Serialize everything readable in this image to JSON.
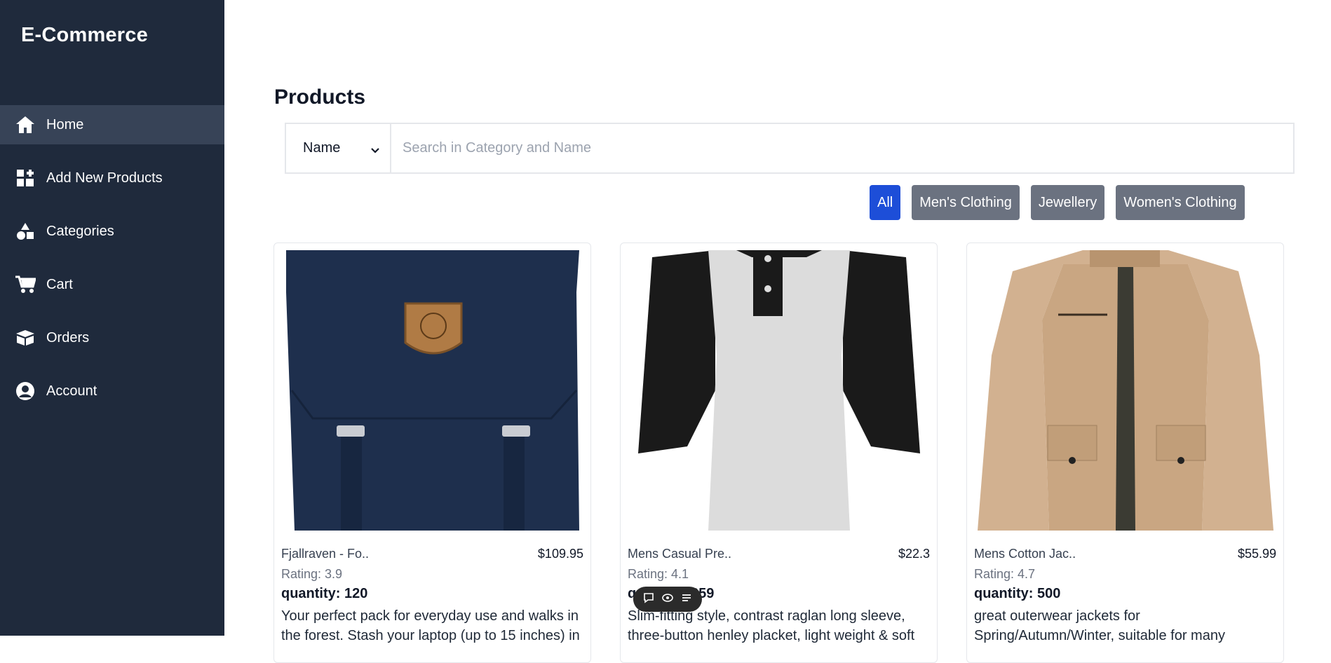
{
  "brand": "E-Commerce",
  "nav": [
    {
      "label": "Home",
      "icon": "home-icon",
      "active": true
    },
    {
      "label": "Add New Products",
      "icon": "grid-add-icon"
    },
    {
      "label": "Categories",
      "icon": "shapes-icon"
    },
    {
      "label": "Cart",
      "icon": "cart-icon"
    },
    {
      "label": "Orders",
      "icon": "box-icon"
    },
    {
      "label": "Account",
      "icon": "user-circle-icon"
    }
  ],
  "page": {
    "title": "Products"
  },
  "search": {
    "select_value": "Name",
    "placeholder": "Search in Category and Name"
  },
  "filters": [
    {
      "label": "All",
      "active": true
    },
    {
      "label": "Men's Clothing"
    },
    {
      "label": "Jewellery"
    },
    {
      "label": "Women's Clothing"
    }
  ],
  "products": [
    {
      "name": "Fjallraven - Fo..",
      "price": "$109.95",
      "rating": "Rating: 3.9",
      "quantity_label": "quantity:",
      "quantity": "120",
      "description": "Your perfect pack for everyday use and walks in the forest. Stash your laptop (up to 15 inches) in"
    },
    {
      "name": "Mens Casual Pre..",
      "price": "$22.3",
      "rating": "Rating: 4.1",
      "quantity_label": "quantity:",
      "quantity": "259",
      "description": "Slim-fitting style, contrast raglan long sleeve, three-button henley placket, light weight & soft"
    },
    {
      "name": "Mens Cotton Jac..",
      "price": "$55.99",
      "rating": "Rating: 4.7",
      "quantity_label": "quantity:",
      "quantity": "500",
      "description": "great outerwear jackets for Spring/Autumn/Winter, suitable for many"
    }
  ],
  "colors": {
    "sidebar": "#1f2a3c",
    "accent": "#1d4ed8",
    "chip": "#6b7280"
  }
}
